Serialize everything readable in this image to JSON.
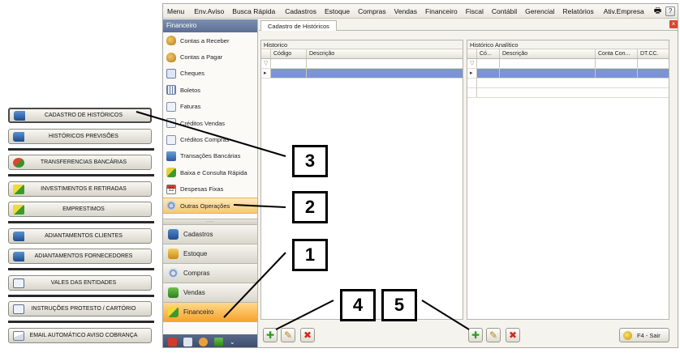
{
  "menubar": {
    "items": [
      "Menu",
      "Env.Aviso",
      "Busca Rápida",
      "Cadastros",
      "Estoque",
      "Compras",
      "Vendas",
      "Financeiro",
      "Fiscal",
      "Contábil",
      "Gerencial",
      "Relatórios",
      "Ativ.Empresa"
    ]
  },
  "sidebar": {
    "header": "Financeiro",
    "items": [
      {
        "label": "Contas a Receber",
        "icon": "money-bag-icon"
      },
      {
        "label": "Contas a Pagar",
        "icon": "money-bag-icon"
      },
      {
        "label": "Cheques",
        "icon": "check-doc-icon"
      },
      {
        "label": "Boletos",
        "icon": "barcode-icon"
      },
      {
        "label": "Faturas",
        "icon": "invoice-icon"
      },
      {
        "label": "Créditos Vendas",
        "icon": "document-icon"
      },
      {
        "label": "Créditos Compras",
        "icon": "document-icon"
      },
      {
        "label": "Transações Bancárias",
        "icon": "card-icon"
      },
      {
        "label": "Baixa e Consulta Rápida",
        "icon": "money-arrow-icon"
      },
      {
        "label": "Despesas Fixas",
        "icon": "calendar-icon"
      },
      {
        "label": "Outras Operações",
        "icon": "paperclip-icon"
      }
    ],
    "modules": [
      "Cadastros",
      "Estoque",
      "Compras",
      "Vendas",
      "Financeiro"
    ]
  },
  "tab": {
    "label": "Cadastro de Históricos"
  },
  "historico": {
    "title": "Historico",
    "columns": [
      "Código",
      "Descrição"
    ],
    "filter_glyph": "▽",
    "row_indicator": "▸"
  },
  "analitico": {
    "title": "Histórico Analítico",
    "columns": [
      "Có...",
      "Descrição",
      "Conta Con...",
      "DT.CC."
    ],
    "filter_glyph": "▽",
    "row_indicator": "▸"
  },
  "exit_button": {
    "label": "F4 - Sair"
  },
  "overlay_buttons": [
    {
      "label": "CADASTRO DE HISTÓRICOS",
      "icon": "book-icon"
    },
    {
      "label": "HISTÓRICOS PREVISÕES",
      "icon": "book-icon"
    },
    {
      "label": "TRANSFERENCIAS BANCÁRIAS",
      "icon": "transfer-icon"
    },
    {
      "label": "INVESTIMENTOS E RETIRADAS",
      "icon": "money-arrow-icon"
    },
    {
      "label": "EMPRESTIMOS",
      "icon": "money-arrow-icon"
    },
    {
      "label": "ADIANTAMENTOS CLIENTES",
      "icon": "book-icon"
    },
    {
      "label": "ADIANTAMENTOS FORNECEDORES",
      "icon": "book-icon"
    },
    {
      "label": "VALES DAS ENTIDADES",
      "icon": "document-icon"
    },
    {
      "label": "INSTRUÇÕES PROTESTO / CARTÓRIO",
      "icon": "document-icon"
    },
    {
      "label": "EMAIL AUTOMÁTICO AVISO COBRANÇA",
      "icon": "mail-icon"
    }
  ],
  "callouts": [
    "1",
    "2",
    "3",
    "4",
    "5"
  ]
}
